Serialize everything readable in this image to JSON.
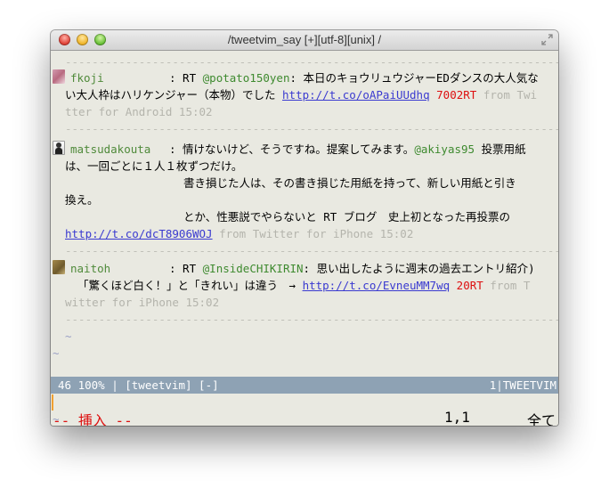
{
  "window": {
    "title": "/tweetvim_say [+][utf-8][unix]  /"
  },
  "separator": "-------------------------------------------------------------------------------------",
  "tweets": [
    {
      "user": "fkoji",
      "line1_pre": ": RT ",
      "line1_mention": "@potato150yen",
      "line1_text": ": 本日のキョウリュウジャーEDダンスの大人気な",
      "line2_text": "い大人枠はハリケンジャー（本物）でした ",
      "url": "http://t.co/oAPaiUUdhq",
      "rt_count": "7002RT",
      "meta_tail": " from Twi",
      "line3_meta": "tter for Android  15:02"
    },
    {
      "user": "matsudakouta",
      "line1_text": ": 情けないけど、そうですね。提案してみます。",
      "line1_mention": "@akiyas95",
      "line1_tail": " 投票用紙",
      "line2_text": "は、一回ごとに１人１枚ずつだけ。",
      "line3_text": "書き損じた人は、その書き損じた用紙を持って、新しい用紙と引き",
      "line4_text": "換え。",
      "line5_text": "とか、性悪説でやらないと RT ブログ　史上初となった再投票の",
      "url": "http://t.co/dcT8906WOJ",
      "meta": " from Twitter for iPhone  15:02"
    },
    {
      "user": "naitoh",
      "line1_pre": ": RT ",
      "line1_mention": "@InsideCHIKIRIN",
      "line1_text": ": 思い出したように週末の過去エントリ紹介)",
      "line2_text": "「驚くほど白く！」と「きれい」は違う　→ ",
      "url": "http://t.co/EvneuMM7wq",
      "rt_count": "20RT",
      "meta_tail": " from T",
      "line3_meta": "witter for iPhone  15:02"
    }
  ],
  "tilde": "~",
  "statusline": {
    "left": "46 100% | [tweetvim] [-]",
    "right": "1|TWEETVIM"
  },
  "bottom": {
    "mode": "-- 挿入 --",
    "position": "1,1",
    "scroll": "全て"
  }
}
